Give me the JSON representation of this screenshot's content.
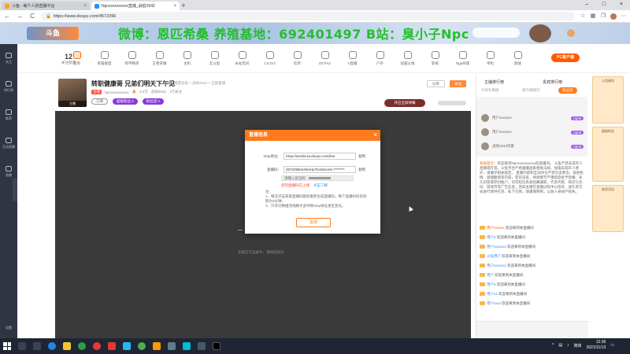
{
  "browser": {
    "tabs": [
      {
        "title": "斗鱼 - 每个人的直播平台",
        "active": false
      },
      {
        "title": "Npcxxxxxxxxxx直播_战伯2042",
        "active": true
      }
    ],
    "url": "https://www.douyu.com/4572396",
    "back": "←",
    "forward": "→",
    "reload": "C"
  },
  "banner": {
    "logo": "斗鱼",
    "overlay": "微博：恩匹希桑 养殖基地：692401497 B站：臭小子Npc"
  },
  "leftnav": [
    "关注",
    "排行榜",
    "推荐",
    "互动直播",
    "直播"
  ],
  "leftnav_bottom": "设置",
  "catbar": {
    "count": "12",
    "count_label": "关注频道",
    "items": [
      "签到",
      "英雄联盟",
      "和平精英",
      "王者荣耀",
      "主机",
      "云斗鱼",
      "永劫无间",
      "CS:GO",
      "吃鸡",
      "DOTA2",
      "V直播",
      "户外",
      "穿越火线",
      "影视",
      "Nga商城",
      "单机",
      "颜值"
    ],
    "pc_button": "PC客户端"
  },
  "room": {
    "title": "转职健康哥 兄弟们明天下午见",
    "meta": "举报 · 网游竞技 > 战地2042 > 全部直播",
    "level_label": "Lv.6",
    "anchor_level": "主播",
    "host_tag": "主播",
    "host_name": "Npcxxxxxxxxxx",
    "stat1": "3.4万",
    "stat2": "战地2042",
    "stat3": "1万关注",
    "pills": [
      "订阅",
      "超级粉丝 6",
      "粉丝团 2"
    ],
    "actions": [
      "分享",
      "关注"
    ],
    "report": "开启全屏弹幕",
    "loading": "主播正在准备中，请稍后再试"
  },
  "modal": {
    "title": "直播信息",
    "close": "×",
    "rtmp_label": "rtmp地址：",
    "rtmp_value": "rtmp://sendtc1a.douyu.com/live",
    "code_label": "直播码：",
    "code_value": "4572396rsH5iAHp?txsSecret=********",
    "copy": "复制",
    "verify_placeholder": "请输入验证码",
    "warn": "您的直播码已上线",
    "warn_link": "点击了解",
    "notes": [
      "注：",
      "1、每次点击获取直播码都会重新生成直播码，每个直播码的有效期为3分钟。",
      "2、只有切换推流线路才会导致rtmp地址发生变化。"
    ],
    "ok": "关闭"
  },
  "rightpanel": {
    "tab1": "主播排行榜",
    "tab2": "贵宾排行榜",
    "sub1": "今日礼物排",
    "sub2": "周礼物排行",
    "sub3": "粉丝团",
    "ranks": [
      {
        "name": "用户xxxxxxx",
        "badge": "npc6"
      },
      {
        "name": "用户xxxxxxx",
        "badge": "npc6"
      },
      {
        "name": "战地2042玩家",
        "badge": "npc6"
      }
    ],
    "sysmsg_label": "系统提示：",
    "sysmsg": "欢迎来到Npcxxxxxxxxxx的直播间。 斗鱼严禁未成年人直播或打赏。斗鱼平台严格遵循国家相关法规，加强未成年人保护，请遵守相关规定。 直播内容和互动评论严禁包含政治、低俗色情、吸烟酗酒等内容，若有违反，将视情节严重程度给予禁播、永久封禁或停封账户。切勿轻信各类招募兼职、代充代练、购买礼包码、游戏币等广告信息，且如主播在直播过程中以陪玩、送礼等方式进行诱导打赏、私下交易，请谨慎判断，以防人身财产损失。",
    "chats": [
      {
        "user": "用户xxxxxx",
        "text": "欢迎来到本直播间",
        "red": true
      },
      {
        "user": "用户6",
        "text": "欢迎来到本直播间",
        "red": false
      },
      {
        "user": "用户xxxxxxx",
        "text": "欢迎来到本直播间",
        "red": false
      },
      {
        "user": "火焰用户",
        "text": "欢迎来到本直播间",
        "red": false
      },
      {
        "user": "用户xxxxxxx",
        "text": "欢迎来到本直播间",
        "red": false
      },
      {
        "user": "用户",
        "text": "欢迎来到本直播间",
        "red": false
      },
      {
        "user": "用户8",
        "text": "欢迎来到本直播间",
        "red": false
      },
      {
        "user": "用户x1",
        "text": "欢迎来到本直播间",
        "red": false
      },
      {
        "user": "用户xxxx",
        "text": "欢迎来到本直播间",
        "red": false
      }
    ]
  },
  "ads": [
    "斗鱼福利",
    "超级粉丝",
    "抽奖活动"
  ],
  "taskbar": {
    "time": "12:36",
    "date": "2021/11/13",
    "ime": "简体"
  },
  "colors": {
    "accent": "#ff7a1b",
    "player_bg": "#3a3a3a",
    "overlay_text": "#22c02a",
    "sidebar": "#2f3542"
  }
}
